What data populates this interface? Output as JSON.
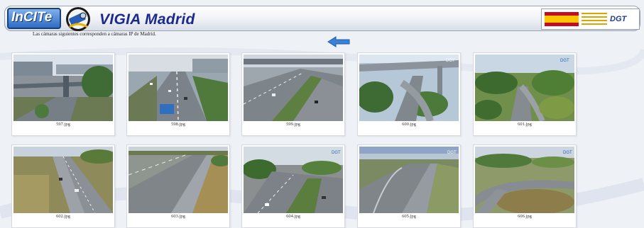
{
  "header": {
    "logo_main": "InCITe",
    "title": "VIGIA Madrid",
    "gov_logo_label": "DGT"
  },
  "subtitle": "Las cámaras siguientes corresponden a cámaras IP de Madrid.",
  "cameras": [
    {
      "caption": "597.jpg"
    },
    {
      "caption": "598.jpg"
    },
    {
      "caption": "599.jpg"
    },
    {
      "caption": "600.jpg"
    },
    {
      "caption": "601.jpg"
    },
    {
      "caption": "602.jpg"
    },
    {
      "caption": "603.jpg"
    },
    {
      "caption": "604.jpg"
    },
    {
      "caption": "605.jpg"
    },
    {
      "caption": "606.jpg"
    }
  ],
  "colors": {
    "title": "#1b2a8c",
    "back_arrow": "#3a7fd8"
  },
  "icons": {
    "back": "back-arrow-icon",
    "camera": "camera-icon"
  }
}
